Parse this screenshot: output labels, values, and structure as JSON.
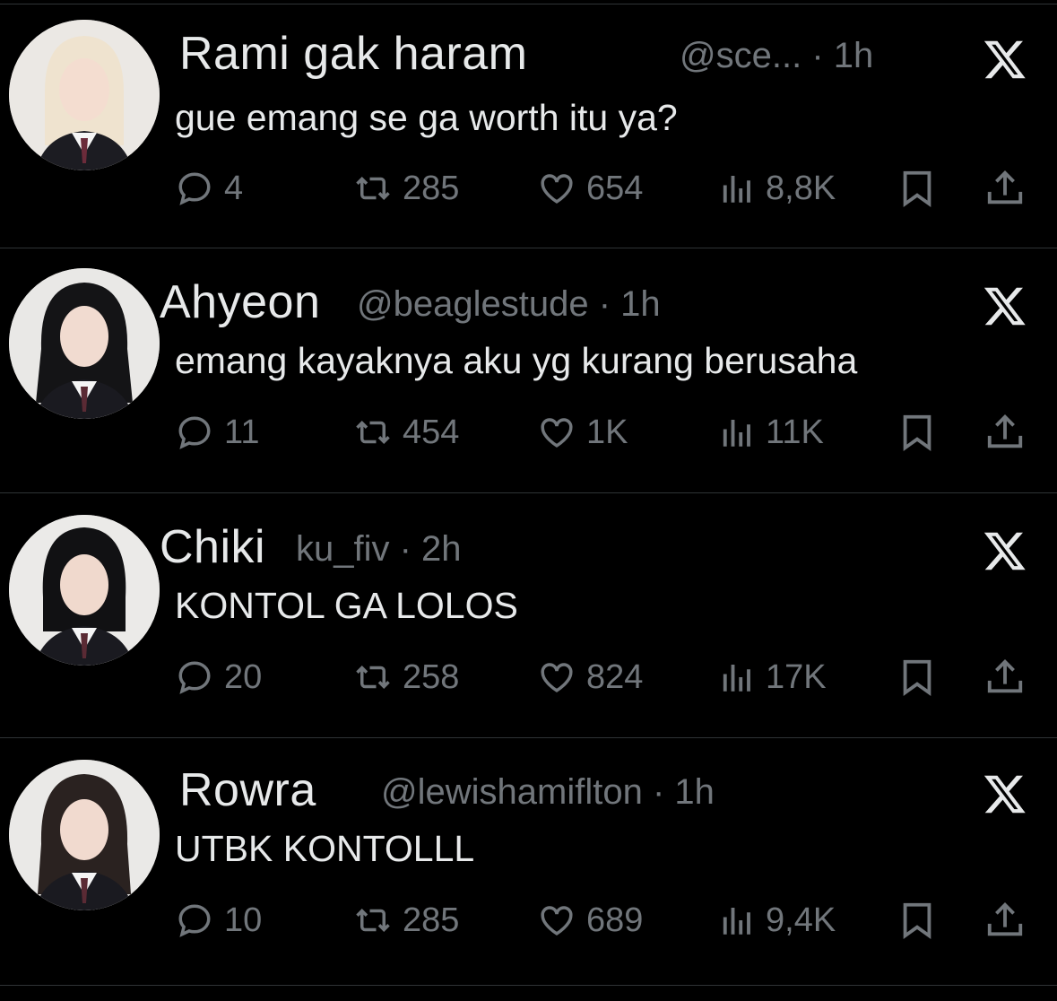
{
  "colors": {
    "background": "#000000",
    "text": "#e7e9ea",
    "muted": "#71767b",
    "divider": "#2f3336"
  },
  "tweets": [
    {
      "name": "Rami gak haram",
      "handle": "@sce...",
      "time": "· 1h",
      "text": "gue emang se ga worth itu ya?",
      "replies": "4",
      "reposts": "285",
      "likes": "654",
      "views": "8,8K"
    },
    {
      "name": "Ahyeon",
      "handle": "@beaglestude",
      "time": "· 1h",
      "text": "emang kayaknya aku yg kurang berusaha",
      "replies": "11",
      "reposts": "454",
      "likes": "1K",
      "views": "11K"
    },
    {
      "name": "Chiki",
      "handle": "ku_fiv",
      "time": "· 2h",
      "text": "KONTOL GA LOLOS",
      "replies": "20",
      "reposts": "258",
      "likes": "824",
      "views": "17K"
    },
    {
      "name": "Rowra",
      "handle": "@lewishamiflton",
      "time": "· 1h",
      "text": "UTBK KONTOLLL",
      "replies": "10",
      "reposts": "285",
      "likes": "689",
      "views": "9,4K"
    }
  ],
  "icons": {
    "reply": "reply-icon",
    "repost": "repost-icon",
    "like": "heart-icon",
    "views": "views-icon",
    "bookmark": "bookmark-icon",
    "share": "share-icon",
    "brand": "x-logo-icon"
  }
}
